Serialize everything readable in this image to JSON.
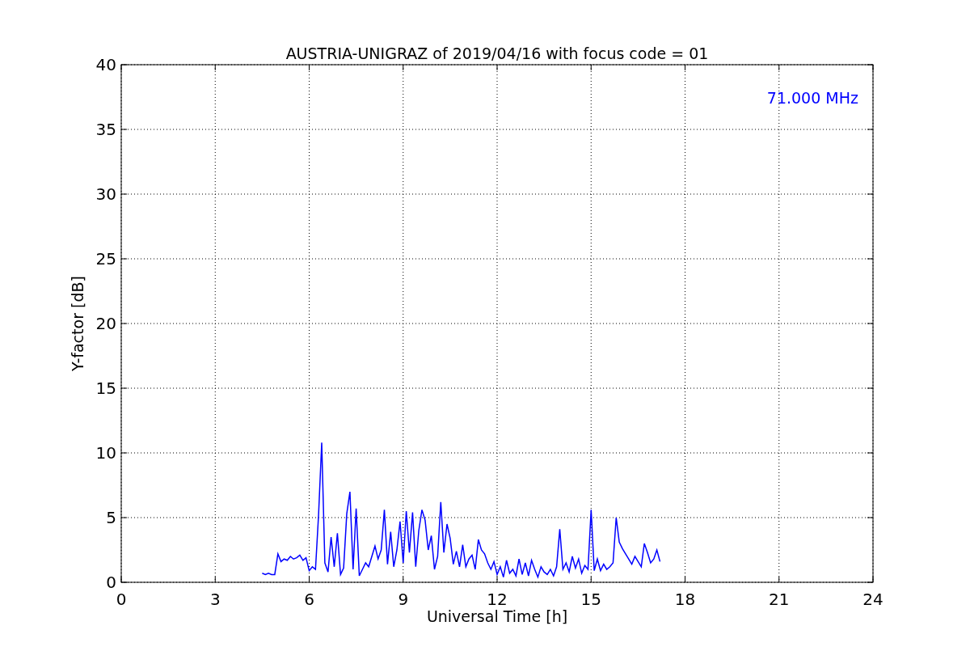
{
  "figure": {
    "chart_data": {
      "type": "line",
      "title": "AUSTRIA-UNIGRAZ of 2019/04/16 with focus code = 01",
      "xlabel": "Universal Time [h]",
      "ylabel": "Y-factor [dB]",
      "grid": true,
      "xlim": [
        0,
        24
      ],
      "ylim": [
        0,
        40
      ],
      "xticks": [
        0,
        3,
        6,
        9,
        12,
        15,
        18,
        21,
        24
      ],
      "yticks": [
        0,
        5,
        10,
        15,
        20,
        25,
        30,
        35,
        40
      ],
      "x": [
        4.5,
        4.6,
        4.7,
        4.8,
        4.9,
        5.0,
        5.1,
        5.2,
        5.3,
        5.4,
        5.5,
        5.6,
        5.7,
        5.8,
        5.9,
        6.0,
        6.1,
        6.2,
        6.3,
        6.4,
        6.5,
        6.6,
        6.7,
        6.8,
        6.9,
        7.0,
        7.1,
        7.2,
        7.3,
        7.4,
        7.5,
        7.6,
        7.7,
        7.8,
        7.9,
        8.0,
        8.1,
        8.2,
        8.3,
        8.4,
        8.5,
        8.6,
        8.7,
        8.8,
        8.9,
        9.0,
        9.1,
        9.2,
        9.3,
        9.4,
        9.5,
        9.6,
        9.7,
        9.8,
        9.9,
        10.0,
        10.1,
        10.2,
        10.3,
        10.4,
        10.5,
        10.6,
        10.7,
        10.8,
        10.9,
        11.0,
        11.1,
        11.2,
        11.3,
        11.4,
        11.5,
        11.6,
        11.7,
        11.8,
        11.9,
        12.0,
        12.1,
        12.2,
        12.3,
        12.4,
        12.5,
        12.6,
        12.7,
        12.8,
        12.9,
        13.0,
        13.1,
        13.2,
        13.3,
        13.4,
        13.5,
        13.6,
        13.7,
        13.8,
        13.9,
        14.0,
        14.1,
        14.2,
        14.3,
        14.4,
        14.5,
        14.6,
        14.7,
        14.8,
        14.9,
        15.0,
        15.1,
        15.2,
        15.3,
        15.4,
        15.5,
        15.6,
        15.7,
        15.8,
        15.9,
        16.0,
        16.1,
        16.2,
        16.3,
        16.4,
        16.5,
        16.6,
        16.7,
        16.8,
        16.9,
        17.0,
        17.1,
        17.2
      ],
      "series": [
        {
          "name": "71.000 MHz",
          "color": "#0000ff",
          "values": [
            0.7,
            0.6,
            0.7,
            0.6,
            0.6,
            2.2,
            1.6,
            1.8,
            1.7,
            2.0,
            1.8,
            1.9,
            2.1,
            1.7,
            1.9,
            0.9,
            1.2,
            1.0,
            5.2,
            10.8,
            1.5,
            0.8,
            3.5,
            1.2,
            3.8,
            0.6,
            1.1,
            5.3,
            7.0,
            1.0,
            5.7,
            0.5,
            1.0,
            1.5,
            1.2,
            2.0,
            2.8,
            1.8,
            2.5,
            5.6,
            1.4,
            3.9,
            1.2,
            2.5,
            4.7,
            1.5,
            5.5,
            2.3,
            5.4,
            1.2,
            4.0,
            5.6,
            4.8,
            2.5,
            3.6,
            1.0,
            2.0,
            6.2,
            2.3,
            4.5,
            3.4,
            1.4,
            2.4,
            1.2,
            2.9,
            1.2,
            1.8,
            2.1,
            1.0,
            3.3,
            2.5,
            2.2,
            1.5,
            1.0,
            1.6,
            0.6,
            1.2,
            0.4,
            1.7,
            0.7,
            1.0,
            0.5,
            1.8,
            0.6,
            1.5,
            0.5,
            1.7,
            1.0,
            0.4,
            1.2,
            0.8,
            0.6,
            1.0,
            0.5,
            1.2,
            4.1,
            1.0,
            1.5,
            0.8,
            2.0,
            1.1,
            1.8,
            0.7,
            1.3,
            1.0,
            5.6,
            0.9,
            1.8,
            0.9,
            1.4,
            1.0,
            1.2,
            1.5,
            5.0,
            3.1,
            2.6,
            2.2,
            1.8,
            1.4,
            2.0,
            1.6,
            1.2,
            3.0,
            2.3,
            1.5,
            1.8,
            2.5,
            1.6
          ]
        }
      ]
    }
  }
}
